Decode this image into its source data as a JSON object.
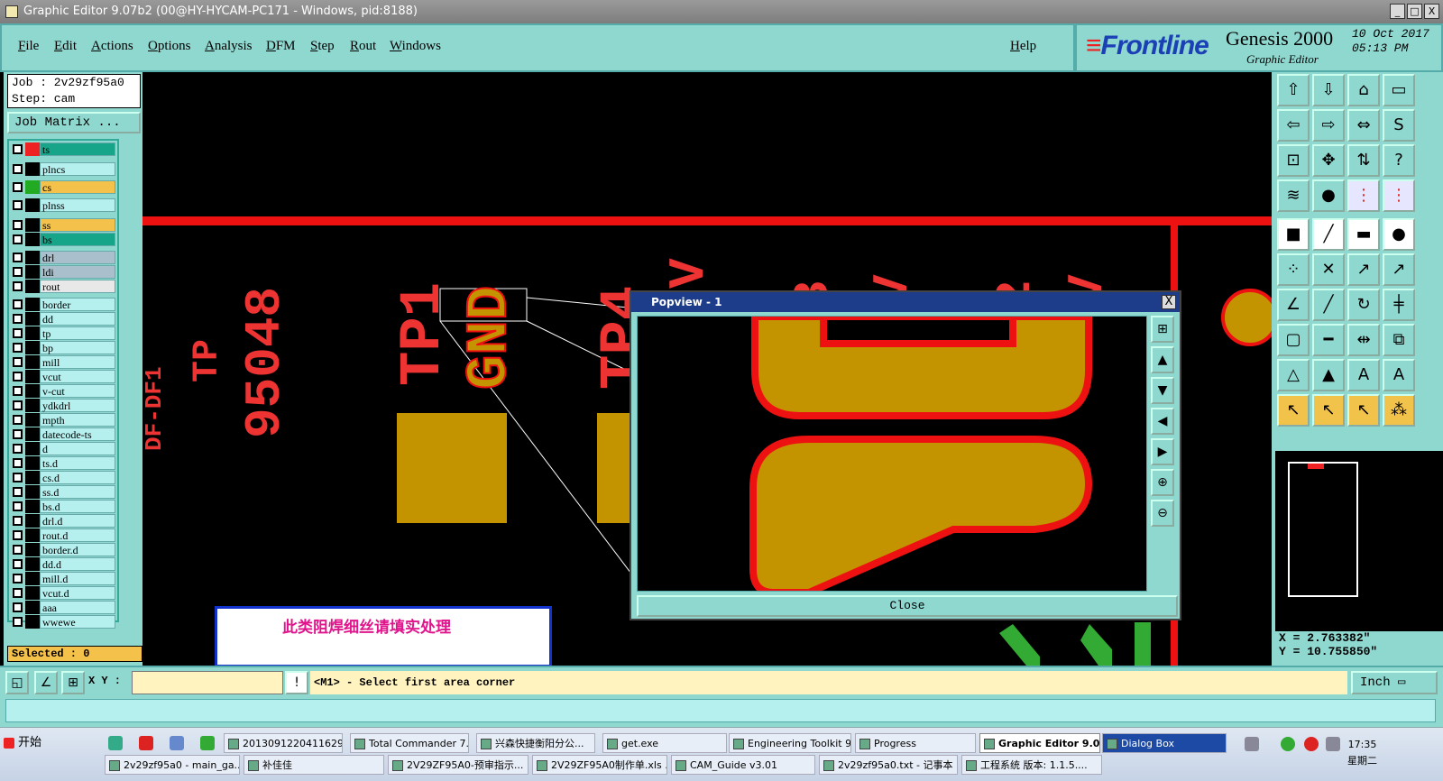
{
  "window": {
    "title": "Graphic Editor 9.07b2 (00@HY-HYCAM-PC171 - Windows, pid:8188)",
    "controls": [
      "_",
      "□",
      "X"
    ]
  },
  "menu": {
    "items": [
      "File",
      "Edit",
      "Actions",
      "Options",
      "Analysis",
      "DFM",
      "Step",
      "Rout",
      "Windows"
    ],
    "help": "Help"
  },
  "brand": {
    "logo": "Frontline",
    "product": "Genesis 2000",
    "subtitle": "Graphic Editor",
    "date": "10 Oct 2017",
    "time": "05:13 PM"
  },
  "job": {
    "job_line": "Job : 2v29zf95a0",
    "step_line": "Step: cam",
    "matrix_button": "Job Matrix ..."
  },
  "layers": [
    {
      "name": "ts",
      "color": "#17a589",
      "swatch": "#e22"
    },
    {
      "name": "plncs",
      "color": "#b6f0ee",
      "swatch": "#000"
    },
    {
      "name": "cs",
      "color": "#f4c24a",
      "swatch": "#2a2"
    },
    {
      "name": "plnss",
      "color": "#b6f0ee",
      "swatch": "#000"
    },
    {
      "name": "ss",
      "color": "#f4c24a",
      "swatch": "#000"
    },
    {
      "name": "bs",
      "color": "#17a589",
      "swatch": "#000"
    },
    {
      "name": "drl",
      "color": "#a9c0cc",
      "swatch": "#000"
    },
    {
      "name": "ldi",
      "color": "#a9c0cc",
      "swatch": "#000"
    },
    {
      "name": "rout",
      "color": "#e8e8e8",
      "swatch": "#000"
    },
    {
      "name": "border",
      "color": "#b6f0ee",
      "swatch": "#000"
    },
    {
      "name": "dd",
      "color": "#b6f0ee",
      "swatch": "#000"
    },
    {
      "name": "tp",
      "color": "#b6f0ee",
      "swatch": "#000"
    },
    {
      "name": "bp",
      "color": "#b6f0ee",
      "swatch": "#000"
    },
    {
      "name": "mill",
      "color": "#b6f0ee",
      "swatch": "#000"
    },
    {
      "name": "vcut",
      "color": "#b6f0ee",
      "swatch": "#000"
    },
    {
      "name": "v-cut",
      "color": "#b6f0ee",
      "swatch": "#000"
    },
    {
      "name": "ydkdrl",
      "color": "#b6f0ee",
      "swatch": "#000"
    },
    {
      "name": "mpth",
      "color": "#b6f0ee",
      "swatch": "#000"
    },
    {
      "name": "datecode-ts",
      "color": "#b6f0ee",
      "swatch": "#000"
    },
    {
      "name": "d",
      "color": "#b6f0ee",
      "swatch": "#000"
    },
    {
      "name": "ts.d",
      "color": "#b6f0ee",
      "swatch": "#000"
    },
    {
      "name": "cs.d",
      "color": "#b6f0ee",
      "swatch": "#000"
    },
    {
      "name": "ss.d",
      "color": "#b6f0ee",
      "swatch": "#000"
    },
    {
      "name": "bs.d",
      "color": "#b6f0ee",
      "swatch": "#000"
    },
    {
      "name": "drl.d",
      "color": "#b6f0ee",
      "swatch": "#000"
    },
    {
      "name": "rout.d",
      "color": "#b6f0ee",
      "swatch": "#000"
    },
    {
      "name": "border.d",
      "color": "#b6f0ee",
      "swatch": "#000"
    },
    {
      "name": "dd.d",
      "color": "#b6f0ee",
      "swatch": "#000"
    },
    {
      "name": "mill.d",
      "color": "#b6f0ee",
      "swatch": "#000"
    },
    {
      "name": "vcut.d",
      "color": "#b6f0ee",
      "swatch": "#000"
    },
    {
      "name": "aaa",
      "color": "#b6f0ee",
      "swatch": "#000"
    },
    {
      "name": "wwewe",
      "color": "#b6f0ee",
      "swatch": "#000"
    }
  ],
  "selected": "Selected : 0",
  "canvas_text": {
    "tp1": "TP1",
    "gnd": "GND",
    "tp4": "TP4",
    "num": "95048",
    "num_upper": "TP",
    "side": "DF-DF1",
    "v1": "V",
    "three": "3",
    "v2": "V",
    "two": "2",
    "v3": "V"
  },
  "note": "此类阻焊细丝请填实处理",
  "popview": {
    "title": "Popview - 1",
    "close_label": "Close",
    "close_x": "X",
    "button_icons": [
      "fit-icon",
      "up-icon",
      "down-icon",
      "left-icon",
      "right-icon",
      "zoom-in-icon",
      "zoom-out-icon"
    ]
  },
  "coords": {
    "x": "X =  2.763382\"",
    "y": "Y = 10.755850\""
  },
  "command": {
    "xy_label": "X Y :",
    "xy_value": "",
    "info_icon": "!",
    "message": "<M1> - Select first area corner",
    "units": "Inch"
  },
  "taskbar": {
    "start": "开始",
    "top_row": [
      "2013091220411629...",
      "Total Commander 7....",
      "兴森快捷衡阳分公...",
      "get.exe",
      "Engineering Toolkit 9...",
      "Progress",
      "Graphic Editor 9.0...",
      "Dialog Box"
    ],
    "bottom_row": [
      "2v29zf95a0 - main_ga...",
      "补佳佳",
      "2V29ZF95A0-预审指示...",
      "2V29ZF95A0制作单.xls ...",
      "CAM_Guide v3.01",
      "2v29zf95a0.txt - 记事本",
      "工程系统 版本: 1.1.5...."
    ],
    "time": "17:35",
    "day": "星期二"
  }
}
